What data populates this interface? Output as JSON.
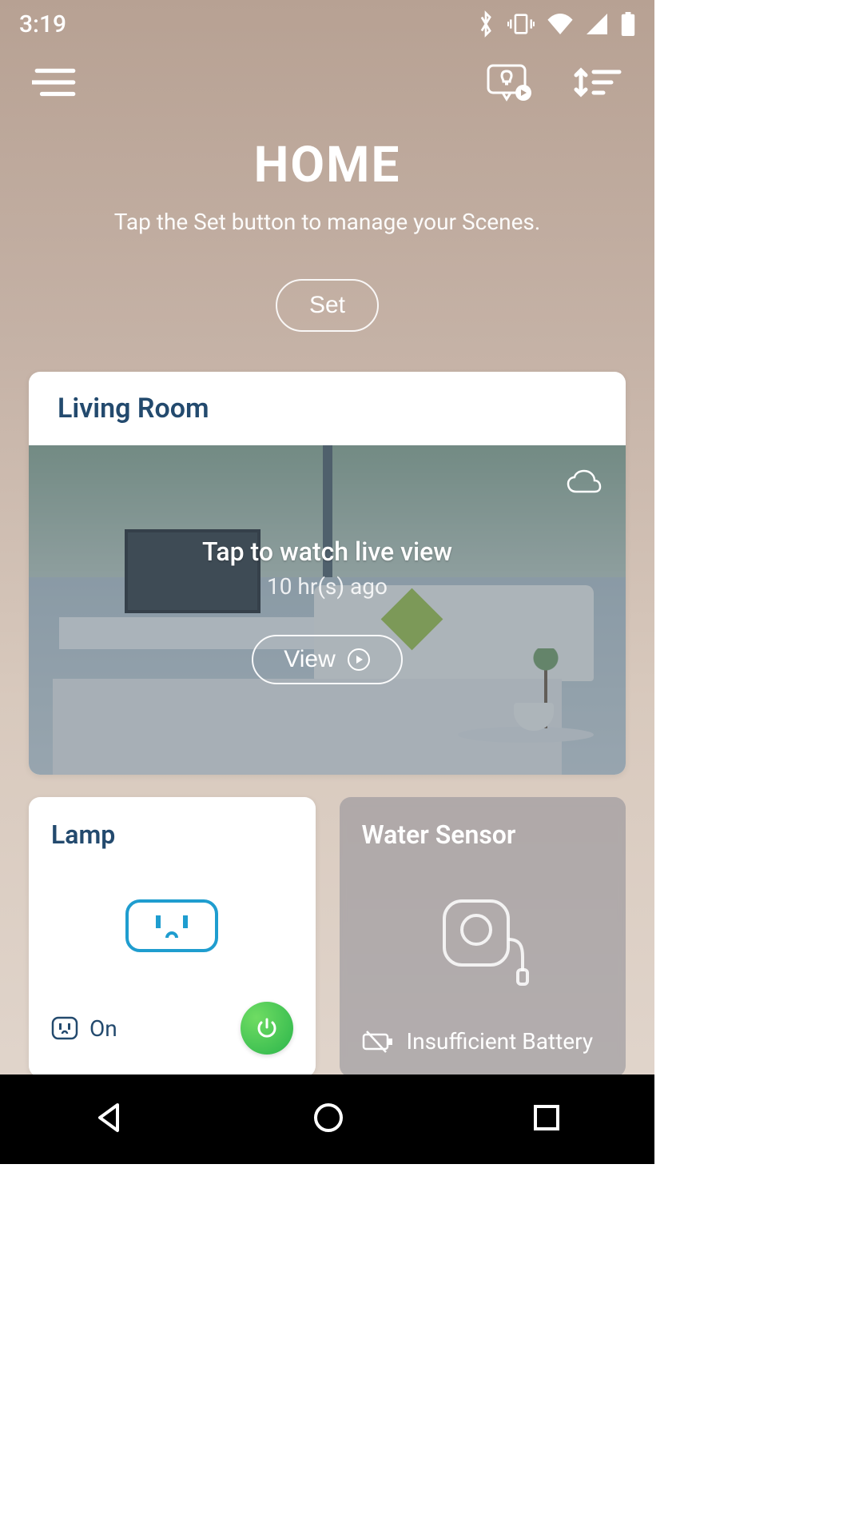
{
  "status": {
    "time": "3:19"
  },
  "header": {
    "title": "HOME",
    "subtitle": "Tap the Set button to manage your Scenes.",
    "set_label": "Set"
  },
  "room": {
    "name": "Living Room",
    "live_title": "Tap to watch live view",
    "live_time": "10 hr(s) ago",
    "view_label": "View"
  },
  "devices": {
    "lamp": {
      "name": "Lamp",
      "status": "On"
    },
    "water_sensor": {
      "name": "Water Sensor",
      "status": "Insufficient Battery"
    }
  }
}
